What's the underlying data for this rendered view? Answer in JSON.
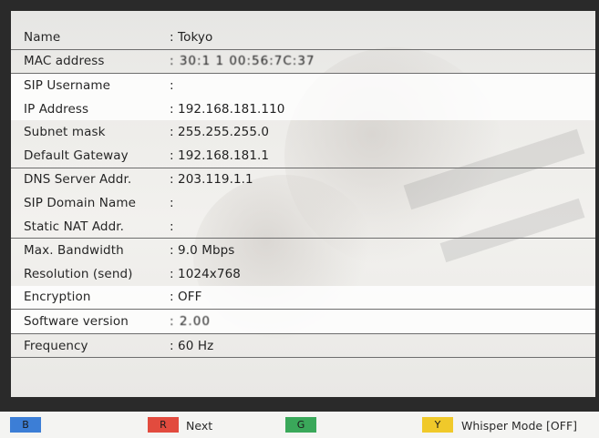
{
  "rows": [
    {
      "label": "Name",
      "value": "Tokyo"
    },
    {
      "label": "MAC address",
      "value": "30:1 1 00:56:7C:37"
    },
    {
      "label": "SIP Username",
      "value": ""
    },
    {
      "label": "IP Address",
      "value": "192.168.181.110"
    },
    {
      "label": "Subnet mask",
      "value": "255.255.255.0"
    },
    {
      "label": "Default Gateway",
      "value": "192.168.181.1"
    },
    {
      "label": "DNS Server Addr.",
      "value": "203.119.1.1"
    },
    {
      "label": "SIP Domain Name",
      "value": ""
    },
    {
      "label": "Static NAT Addr.",
      "value": ""
    },
    {
      "label": "Max. Bandwidth",
      "value": "9.0 Mbps"
    },
    {
      "label": "Resolution (send)",
      "value": "1024x768"
    },
    {
      "label": "Encryption",
      "value": "OFF"
    },
    {
      "label": "Software version",
      "value": "2.00"
    },
    {
      "label": "Frequency",
      "value": "60 Hz"
    }
  ],
  "footer": {
    "b_key": "B",
    "r_key": "R",
    "r_label": "Next",
    "g_key": "G",
    "y_key": "Y",
    "y_label": "Whisper Mode [OFF]"
  },
  "colors": {
    "blue": "#3c7ed6",
    "red": "#e24b3e",
    "green": "#3aa85a",
    "yellow": "#f0c92a"
  }
}
